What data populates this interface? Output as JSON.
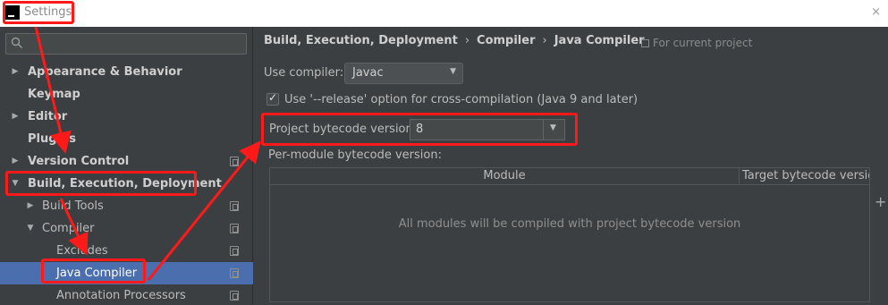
{
  "window": {
    "title": "Settings",
    "close_glyph": "×"
  },
  "search": {
    "placeholder": "",
    "icon": "search-icon"
  },
  "sidebar": {
    "items": [
      {
        "label": "Appearance & Behavior",
        "expanded": false,
        "has_children": true,
        "bold": true
      },
      {
        "label": "Keymap",
        "bold": true
      },
      {
        "label": "Editor",
        "expanded": false,
        "has_children": true,
        "bold": true
      },
      {
        "label": "Plugins",
        "bold": true
      },
      {
        "label": "Version Control",
        "expanded": false,
        "has_children": true,
        "bold": true,
        "project_icon": true
      },
      {
        "label": "Build, Execution, Deployment",
        "expanded": true,
        "has_children": true,
        "bold": true
      },
      {
        "label": "Build Tools",
        "expanded": false,
        "has_children": true,
        "project_icon": true
      },
      {
        "label": "Compiler",
        "expanded": true,
        "has_children": true,
        "project_icon": true
      },
      {
        "label": "Excludes",
        "project_icon": true
      },
      {
        "label": "Java Compiler",
        "selected": true,
        "project_icon": true
      },
      {
        "label": "Annotation Processors",
        "project_icon": true
      }
    ],
    "selection_color": "#4b6eaf"
  },
  "main": {
    "breadcrumb": [
      "Build, Execution, Deployment",
      "Compiler",
      "Java Compiler"
    ],
    "breadcrumb_separator": "›",
    "scope_note": "For current project",
    "use_compiler": {
      "label": "Use compiler:",
      "value": "Javac"
    },
    "release_option": {
      "label": "Use '--release' option for cross-compilation (Java 9 and later)",
      "checked": true
    },
    "bytecode": {
      "label": "Project bytecode version:",
      "value": "8"
    },
    "per_module": {
      "label": "Per-module bytecode version:",
      "columns": [
        "Module",
        "Target bytecode version"
      ],
      "empty_text": "All modules will be compiled with project bytecode version",
      "add_glyph": "+"
    }
  },
  "annotation_color": "#ff1a1a"
}
